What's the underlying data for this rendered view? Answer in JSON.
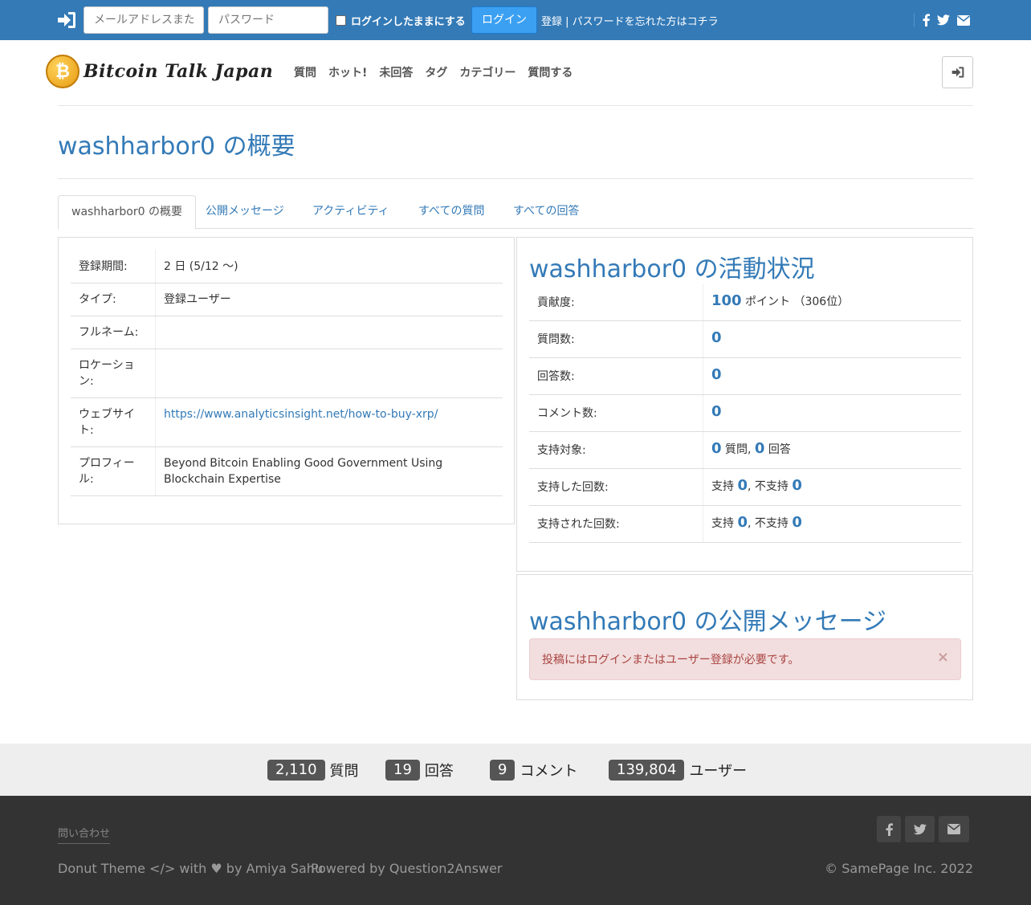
{
  "topbar": {
    "email_placeholder": "メールアドレスまたはユーザー名",
    "password_placeholder": "パスワード",
    "remember_label": "ログインしたままにする",
    "login_label": "ログイン",
    "register_label": "登録",
    "divider": " | ",
    "forgot_label": "パスワードを忘れた方はコチラ"
  },
  "header": {
    "logo_text": "Bitcoin Talk Japan",
    "nav": [
      "質問",
      "ホット!",
      "未回答",
      "タグ",
      "カテゴリー",
      "質問する"
    ]
  },
  "page_title": "washharbor0 の概要",
  "tabs": [
    "washharbor0 の概要",
    "公開メッセージ",
    "アクティビティ",
    "すべての質問",
    "すべての回答"
  ],
  "profile": [
    {
      "label": "登録期間:",
      "value": "2 日 (5/12 ～)"
    },
    {
      "label": "タイプ:",
      "value": "登録ユーザー"
    },
    {
      "label": "フルネーム:",
      "value": ""
    },
    {
      "label": "ロケーション:",
      "value": ""
    },
    {
      "label": "ウェブサイト:",
      "value": "https://www.analyticsinsight.net/how-to-buy-xrp/"
    },
    {
      "label": "プロフィール:",
      "value": "Beyond Bitcoin Enabling Good Government Using Blockchain Expertise"
    }
  ],
  "activity": {
    "title": "washharbor0 の活動状況",
    "points_label": "貢献度:",
    "points": "100",
    "points_unit": " ポイント",
    "rank": "（306位）",
    "questions_label": "質問数:",
    "questions": "0",
    "answers_label": "回答数:",
    "answers": "0",
    "comments_label": "コメント数:",
    "comments": "0",
    "voted_on_label": "支持対象:",
    "voted_q": "0",
    "voted_q_unit": " 質問, ",
    "voted_a": "0",
    "voted_a_unit": " 回答",
    "gave_label": "支持した回数:",
    "gave_up_text": "支持 ",
    "gave_up": "0",
    "gave_down_text": ", 不支持 ",
    "gave_down": "0",
    "received_label": "支持された回数:",
    "received_up_text": "支持 ",
    "received_up": "0",
    "received_down_text": ", 不支持 ",
    "received_down": "0"
  },
  "messages": {
    "title": "washharbor0 の公開メッセージ",
    "alert": "投稿にはログインまたはユーザー登録が必要です。",
    "close": "×"
  },
  "stats": [
    {
      "count": "2,110",
      "label": "質問"
    },
    {
      "count": "19",
      "label": "回答"
    },
    {
      "count": "9",
      "label": "コメント"
    },
    {
      "count": "139,804",
      "label": "ユーザー"
    }
  ],
  "footer": {
    "contact": "問い合わせ",
    "credits_prefix": "Donut Theme ",
    "credits_mid": " with ",
    "credits_suffix": " by Amiya Sahu",
    "powered": "Powered by Question2Answer",
    "copyright": "© SamePage Inc. 2022"
  },
  "icons": [
    "sign-in-icon",
    "facebook-icon",
    "twitter-icon",
    "envelope-icon",
    "code-icon",
    "heart-icon"
  ],
  "colors": {
    "primary": "#337ab7",
    "login_button": "#3ba0f2",
    "alert_bg": "#f2dede",
    "alert_text": "#a94442",
    "footer_bg": "#333333"
  }
}
